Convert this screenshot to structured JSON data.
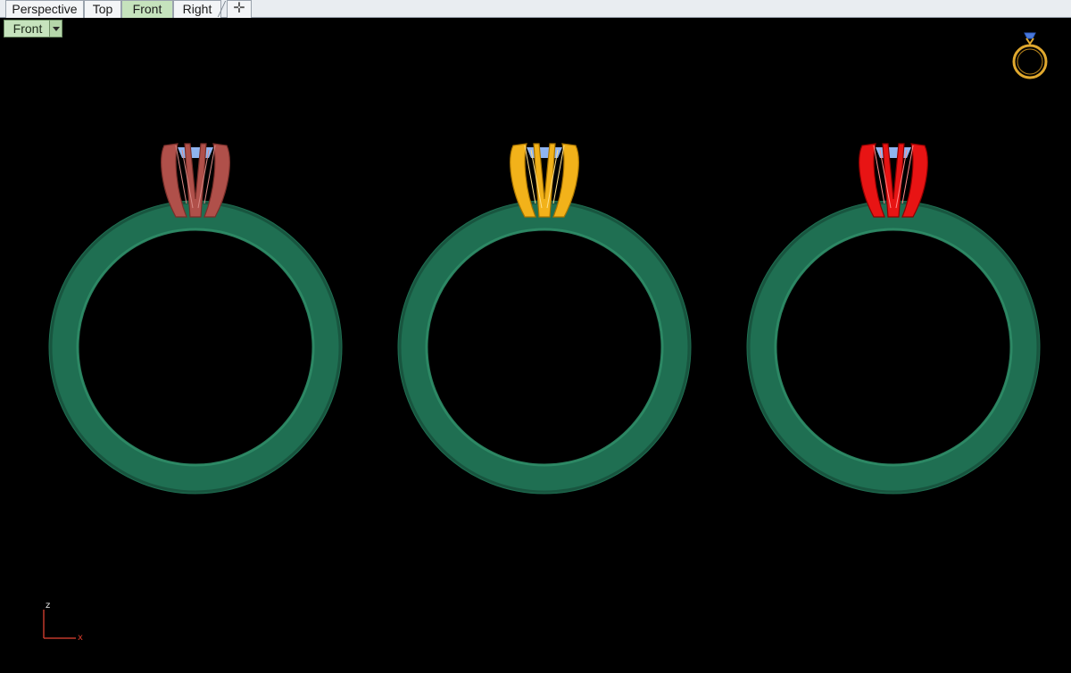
{
  "tabs": [
    {
      "label": "Perspective"
    },
    {
      "label": "Top"
    },
    {
      "label": "Front"
    },
    {
      "label": "Right"
    }
  ],
  "add_tab_icon": "plus-icon",
  "viewport": {
    "label": "Front",
    "dropdown_icon": "chevron-down-icon",
    "background": "#000000"
  },
  "axes": {
    "z": "z",
    "x": "x",
    "color": "#c0392b"
  },
  "rings": [
    {
      "band_color": "#1f6f52",
      "prong_color": "#b0504a",
      "stone_color": "#8fb4f0"
    },
    {
      "band_color": "#1f6f52",
      "prong_color": "#f2b21a",
      "stone_color": "#8fb4f0"
    },
    {
      "band_color": "#1f6f52",
      "prong_color": "#e81414",
      "stone_color": "#8fb4f0"
    }
  ],
  "thumbnail": {
    "icon": "ring-thumbnail-icon",
    "band_color": "#e0a82e",
    "stone_color": "#4a78d8"
  }
}
